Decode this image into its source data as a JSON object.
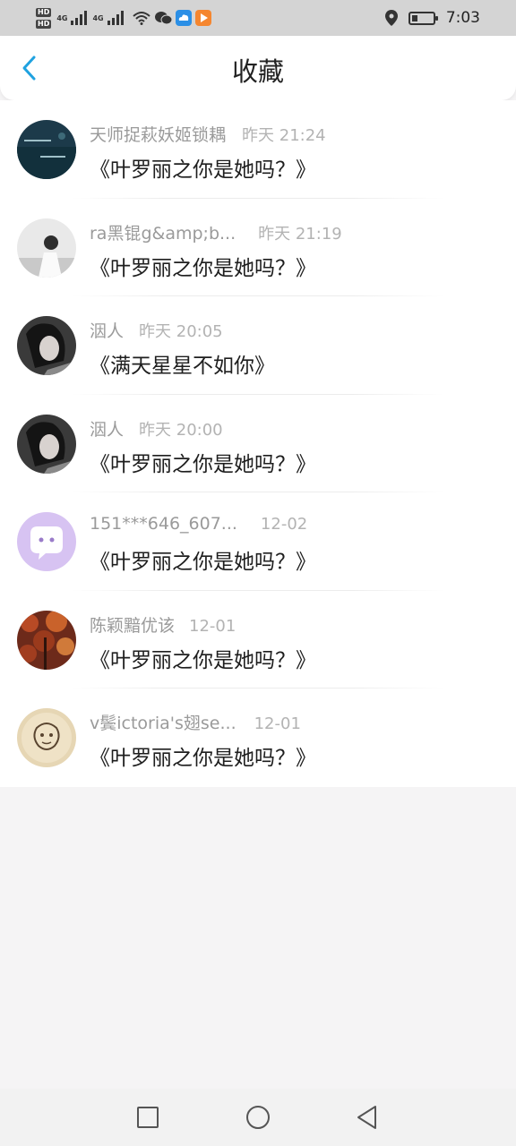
{
  "status_bar": {
    "hd_badges": [
      "HD",
      "HD"
    ],
    "network": [
      "4G",
      "4G"
    ],
    "time": "7:03",
    "battery_level": 0.3,
    "icons": [
      "signal-icon",
      "wifi-icon",
      "wechat-icon",
      "cloud-app-icon",
      "video-app-icon",
      "location-icon",
      "battery-icon"
    ]
  },
  "header": {
    "title": "收藏",
    "back_icon": "chevron-left-icon",
    "accent_color": "#1fa2e0"
  },
  "favorites": [
    {
      "name": "天师捉萩妖姬锁耦",
      "time": "昨天 21:24",
      "content": "《叶罗丽之你是她吗？》"
    },
    {
      "name": "ra黑锟g&amp;b...",
      "time": "昨天 21:19",
      "content": "《叶罗丽之你是她吗？》"
    },
    {
      "name": "洇人",
      "time": "昨天 20:05",
      "content": "《满天星星不如你》"
    },
    {
      "name": "洇人",
      "time": "昨天 20:00",
      "content": "《叶罗丽之你是她吗？》"
    },
    {
      "name": "151***646_607...",
      "time": "12-02",
      "content": "《叶罗丽之你是她吗？》"
    },
    {
      "name": "陈颖黯优该",
      "time": "12-01",
      "content": "《叶罗丽之你是她吗？》"
    },
    {
      "name": "v鬓ictoria's翅se...",
      "time": "12-01",
      "content": "《叶罗丽之你是她吗？》"
    }
  ],
  "nav_bar": {
    "buttons": [
      "recent-apps-icon",
      "home-icon",
      "back-icon"
    ]
  },
  "colors": {
    "background": "#f5f4f5",
    "name_text": "#9a9a9a",
    "time_text": "#b3b3b3",
    "content_text": "#1e1e1e"
  }
}
